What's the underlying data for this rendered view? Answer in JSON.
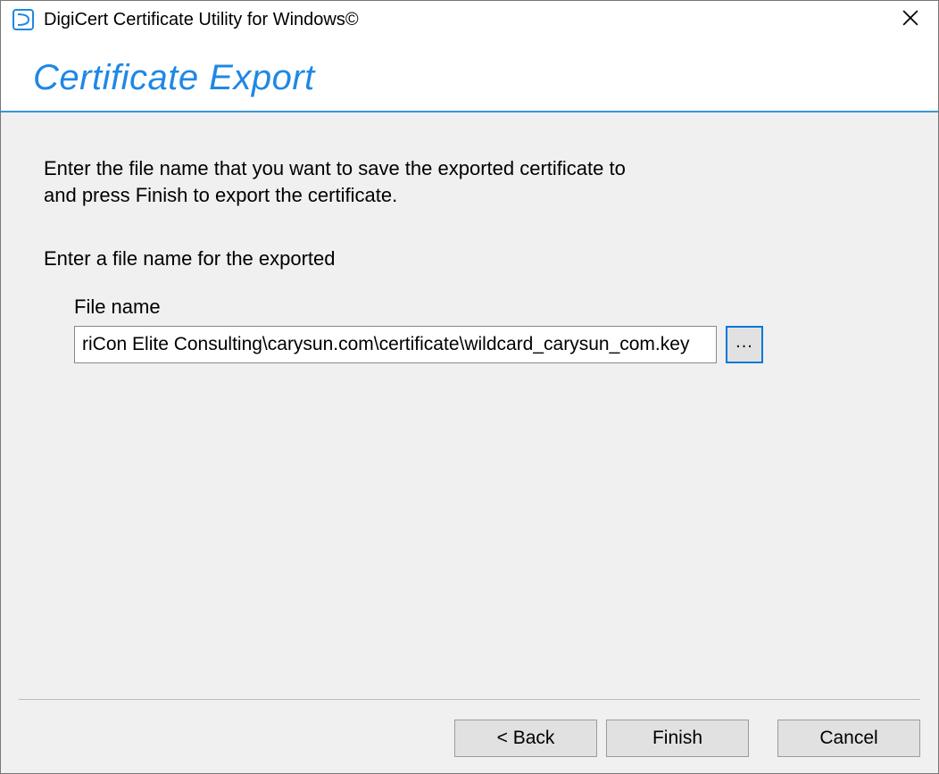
{
  "window": {
    "app_title": "DigiCert Certificate Utility for Windows©"
  },
  "header": {
    "heading": "Certificate Export"
  },
  "content": {
    "instructions": "Enter the file name that you want to save the exported certificate to\nand press Finish to export the certificate.",
    "field_prompt": "Enter a file name for the exported",
    "file_label": "File name",
    "file_value": "riCon Elite Consulting\\carysun.com\\certificate\\wildcard_carysun_com.key",
    "browse_label": "..."
  },
  "buttons": {
    "back": "< Back",
    "finish": "Finish",
    "cancel": "Cancel"
  }
}
